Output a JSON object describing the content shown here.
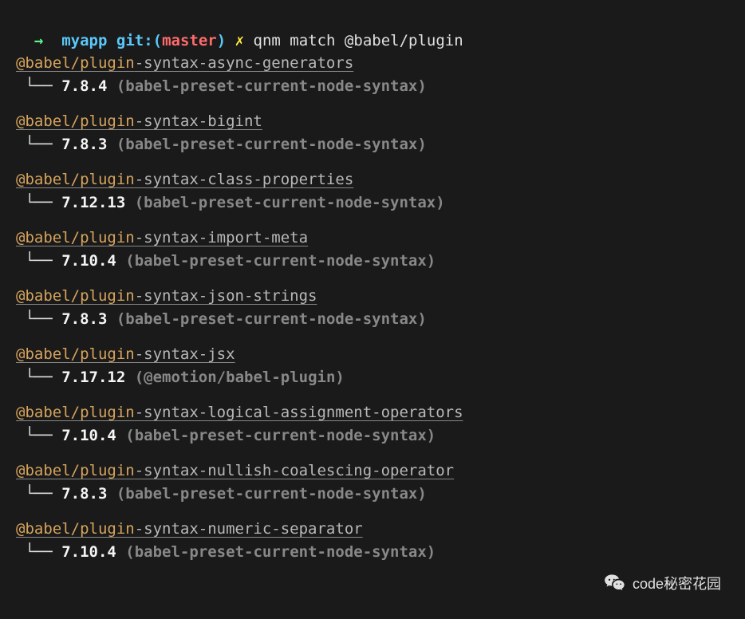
{
  "prompt": {
    "arrow": "→",
    "app": "myapp",
    "git_label": "git:(",
    "branch": "master",
    "close_paren": ")",
    "cross": "✗",
    "command": "qnm match @babel/plugin"
  },
  "packages": [
    {
      "name": "@babel/plugin",
      "suffix": "-syntax-async-generators",
      "version": "7.8.4",
      "parent": "(babel-preset-current-node-syntax)"
    },
    {
      "name": "@babel/plugin",
      "suffix": "-syntax-bigint",
      "version": "7.8.3",
      "parent": "(babel-preset-current-node-syntax)"
    },
    {
      "name": "@babel/plugin",
      "suffix": "-syntax-class-properties",
      "version": "7.12.13",
      "parent": "(babel-preset-current-node-syntax)"
    },
    {
      "name": "@babel/plugin",
      "suffix": "-syntax-import-meta",
      "version": "7.10.4",
      "parent": "(babel-preset-current-node-syntax)"
    },
    {
      "name": "@babel/plugin",
      "suffix": "-syntax-json-strings",
      "version": "7.8.3",
      "parent": "(babel-preset-current-node-syntax)"
    },
    {
      "name": "@babel/plugin",
      "suffix": "-syntax-jsx",
      "version": "7.17.12",
      "parent": "(@emotion/babel-plugin)"
    },
    {
      "name": "@babel/plugin",
      "suffix": "-syntax-logical-assignment-operators",
      "version": "7.10.4",
      "parent": "(babel-preset-current-node-syntax)"
    },
    {
      "name": "@babel/plugin",
      "suffix": "-syntax-nullish-coalescing-operator",
      "version": "7.8.3",
      "parent": "(babel-preset-current-node-syntax)"
    },
    {
      "name": "@babel/plugin",
      "suffix": "-syntax-numeric-separator",
      "version": "7.10.4",
      "parent": "(babel-preset-current-node-syntax)"
    }
  ],
  "tree_prefix": " └── ",
  "watermark": "code秘密花园"
}
